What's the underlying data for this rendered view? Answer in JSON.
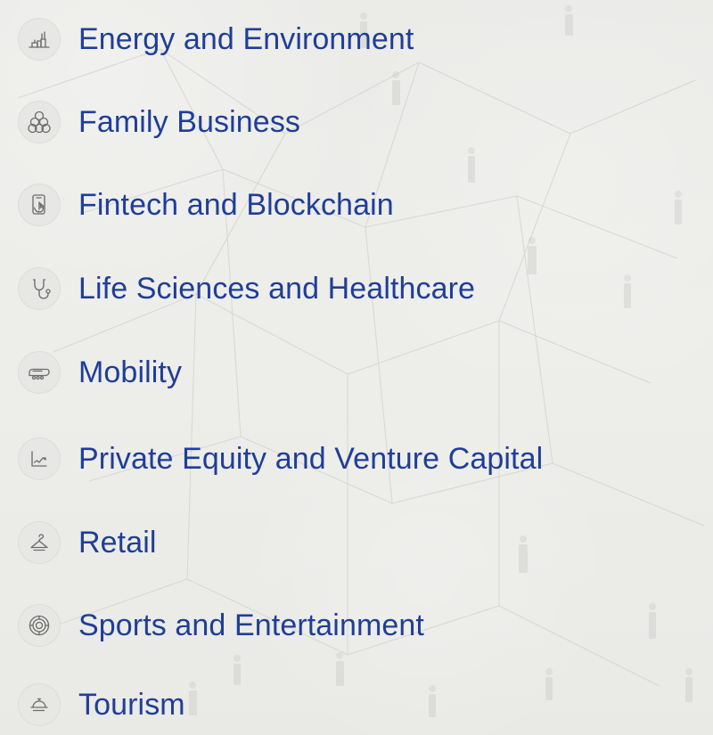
{
  "sectors": [
    {
      "label": "Energy and Environment",
      "icon": "industry-icon"
    },
    {
      "label": "Family Business",
      "icon": "family-icon"
    },
    {
      "label": "Fintech and Blockchain",
      "icon": "mobile-payment-icon"
    },
    {
      "label": "Life Sciences and Healthcare",
      "icon": "stethoscope-icon"
    },
    {
      "label": "Mobility",
      "icon": "train-icon"
    },
    {
      "label": "Private Equity and Venture Capital",
      "icon": "growth-chart-icon"
    },
    {
      "label": "Retail",
      "icon": "hanger-icon"
    },
    {
      "label": "Sports and Entertainment",
      "icon": "target-icon"
    },
    {
      "label": "Tourism",
      "icon": "service-bell-icon"
    }
  ],
  "colors": {
    "text": "#1f3e97",
    "icon": "#6d6d6d",
    "icon_bg": "#e6e6e4",
    "background": "#e9e9e7"
  }
}
